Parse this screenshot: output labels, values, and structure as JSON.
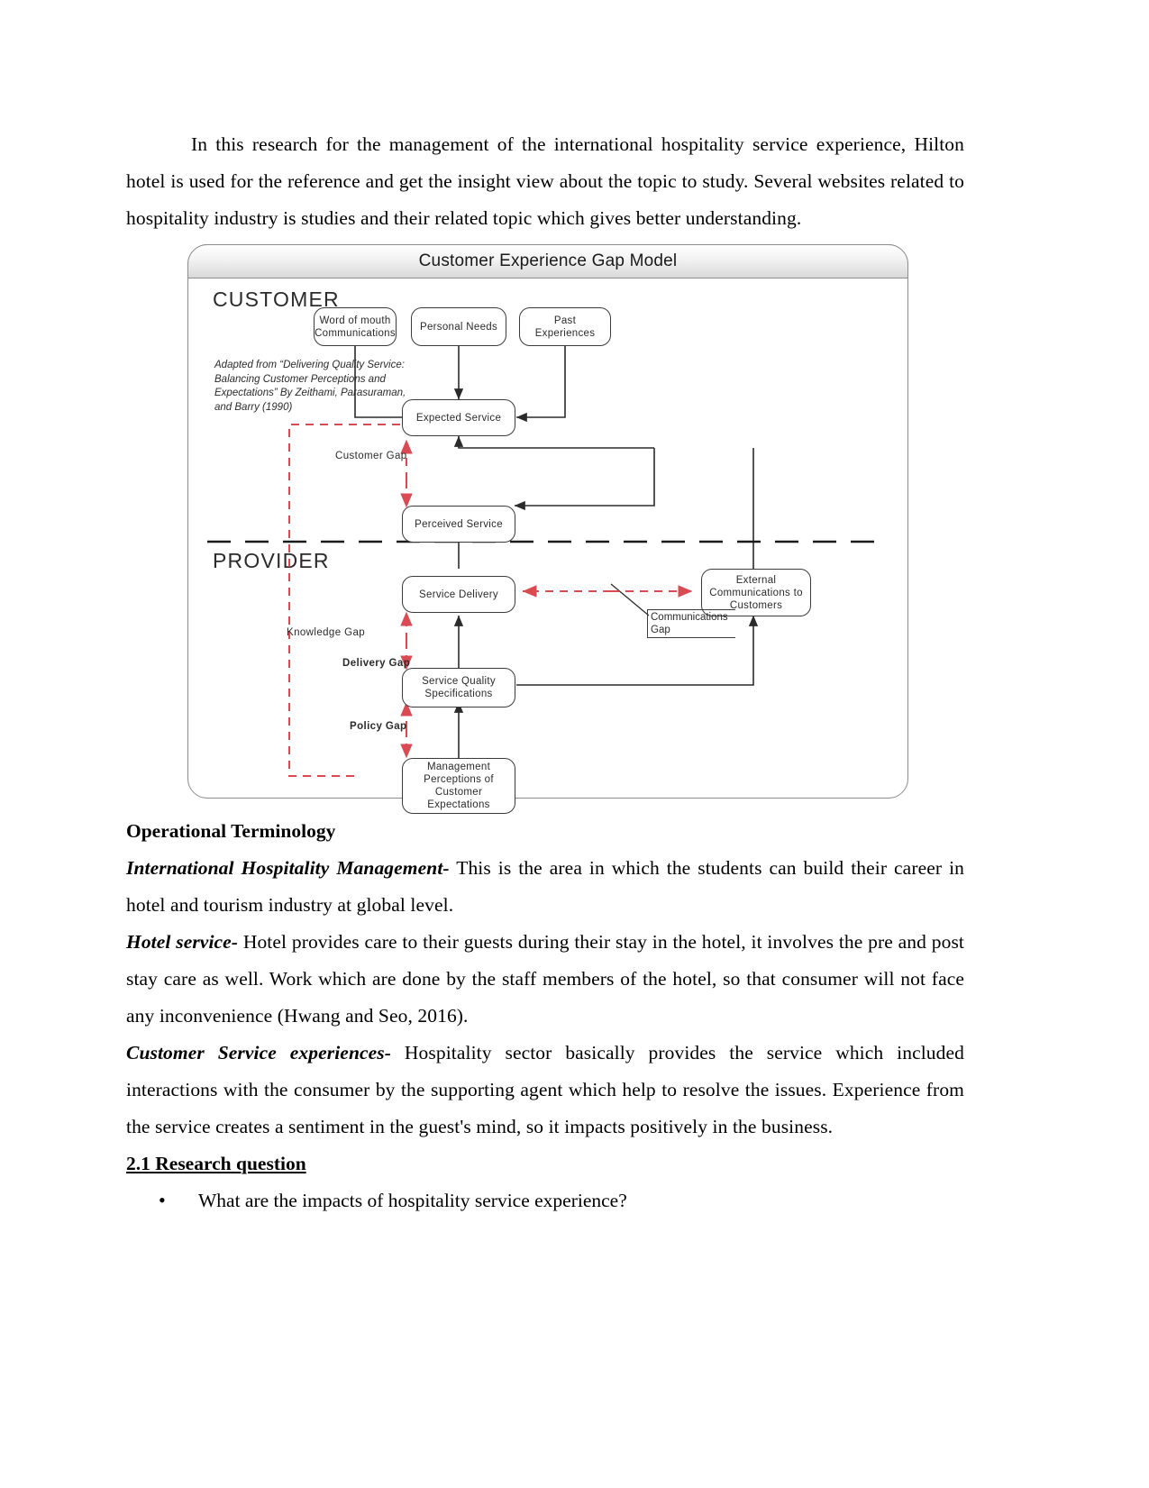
{
  "document": {
    "paragraphs": {
      "intro": "In this research for the management of the international hospitality service experience, Hilton hotel is used for the reference and get the insight view about the topic to study. Several websites related to hospitality industry is studies and their related topic which gives better understanding."
    },
    "sections": {
      "operational_terminology_heading": "Operational Terminology",
      "term_1_label": "International Hospitality Management-",
      "term_1_text": " This is the area in which the students can build their career in hotel and tourism industry at global level.",
      "term_2_label": "Hotel service-",
      "term_2_text": " Hotel provides care to their guests during their stay in the hotel, it involves the pre and post stay care as well. Work which are done by the staff members of the hotel, so that consumer will not face any inconvenience (Hwang and Seo, 2016).",
      "term_3_label": "Customer Service experiences-",
      "term_3_text": " Hospitality sector basically provides the service which included interactions with the consumer by the supporting agent which help to resolve the issues. Experience from the service creates a sentiment in the guest's mind, so it impacts positively in the business.",
      "research_question_heading": "2.1 Research question",
      "research_questions": [
        "What are the impacts of hospitality service experience?"
      ]
    }
  },
  "figure": {
    "title": "Customer Experience Gap Model",
    "zones": {
      "customer": "CUSTOMER",
      "provider": "PROVIDER"
    },
    "attribution": "Adapted from “Delivering Quality Service: Balancing Customer Perceptions and Expectations” By Zeithami, Parasuraman, and Barry (1990)",
    "nodes": [
      {
        "id": "word-of-mouth",
        "label": "Word of mouth Communications"
      },
      {
        "id": "personal-needs",
        "label": "Personal Needs"
      },
      {
        "id": "past-experiences",
        "label": "Past Experiences"
      },
      {
        "id": "expected-service",
        "label": "Expected Service"
      },
      {
        "id": "perceived-service",
        "label": "Perceived Service"
      },
      {
        "id": "service-delivery",
        "label": "Service Delivery"
      },
      {
        "id": "external-communications",
        "label": "External Communications to Customers"
      },
      {
        "id": "service-quality-specifications",
        "label": "Service Quality Specifications"
      },
      {
        "id": "management-perceptions",
        "label": "Management Perceptions of Customer Expectations"
      }
    ],
    "gaps": [
      {
        "id": "customer-gap",
        "label": "Customer Gap"
      },
      {
        "id": "knowledge-gap",
        "label": "Knowledge Gap"
      },
      {
        "id": "delivery-gap",
        "label": "Delivery Gap"
      },
      {
        "id": "policy-gap",
        "label": "Policy Gap"
      },
      {
        "id": "communications-gap",
        "label": "Communications Gap"
      }
    ],
    "colors": {
      "gap_arrow": "#d94a52",
      "flow_arrow": "#2b2b2b",
      "frame_border": "#8c8c8c"
    }
  }
}
